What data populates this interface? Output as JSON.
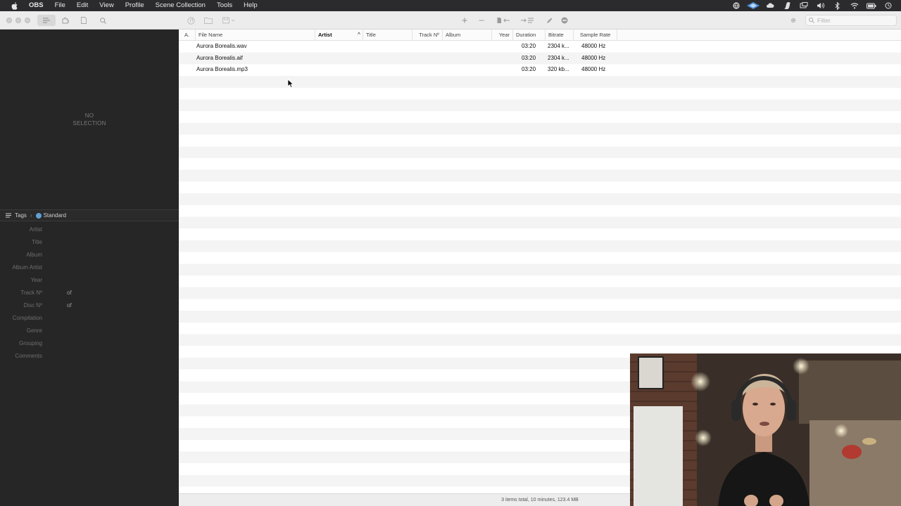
{
  "menubar": {
    "items": [
      "OBS",
      "File",
      "Edit",
      "View",
      "Profile",
      "Scene Collection",
      "Tools",
      "Help"
    ]
  },
  "toolbar": {
    "filter_placeholder": "Filter"
  },
  "left": {
    "no_selection": "NO\nSELECTION",
    "tags_header": {
      "title": "Tags",
      "mode": "Standard"
    },
    "tag_fields": [
      {
        "label": "Artist"
      },
      {
        "label": "Title"
      },
      {
        "label": "Album"
      },
      {
        "label": "Album Artist"
      },
      {
        "label": "Year"
      },
      {
        "label": "Track Nº",
        "of": "of"
      },
      {
        "label": "Disc Nº",
        "of": "of"
      },
      {
        "label": "Compilation"
      },
      {
        "label": "Genre"
      },
      {
        "label": "Grouping"
      },
      {
        "label": "Comments"
      }
    ]
  },
  "table": {
    "columns": [
      {
        "label": "A."
      },
      {
        "label": "File Name"
      },
      {
        "label": "Artist"
      },
      {
        "label": "Title"
      },
      {
        "label": "Track Nº"
      },
      {
        "label": "Album"
      },
      {
        "label": "Year"
      },
      {
        "label": "Duration"
      },
      {
        "label": "Bitrate"
      },
      {
        "label": "Sample Rate"
      }
    ],
    "rows": [
      {
        "file_name": "Aurora Borealis.wav",
        "duration": "03:20",
        "bitrate": "2304 k...",
        "sample_rate": "48000 Hz"
      },
      {
        "file_name": "Aurora Borealis.aif",
        "duration": "03:20",
        "bitrate": "2304 k...",
        "sample_rate": "48000 Hz"
      },
      {
        "file_name": "Aurora Borealis.mp3",
        "duration": "03:20",
        "bitrate": "320 kb...",
        "sample_rate": "48000 Hz"
      }
    ],
    "status": "3 items total, 10 minutes, 123.4 MB"
  }
}
